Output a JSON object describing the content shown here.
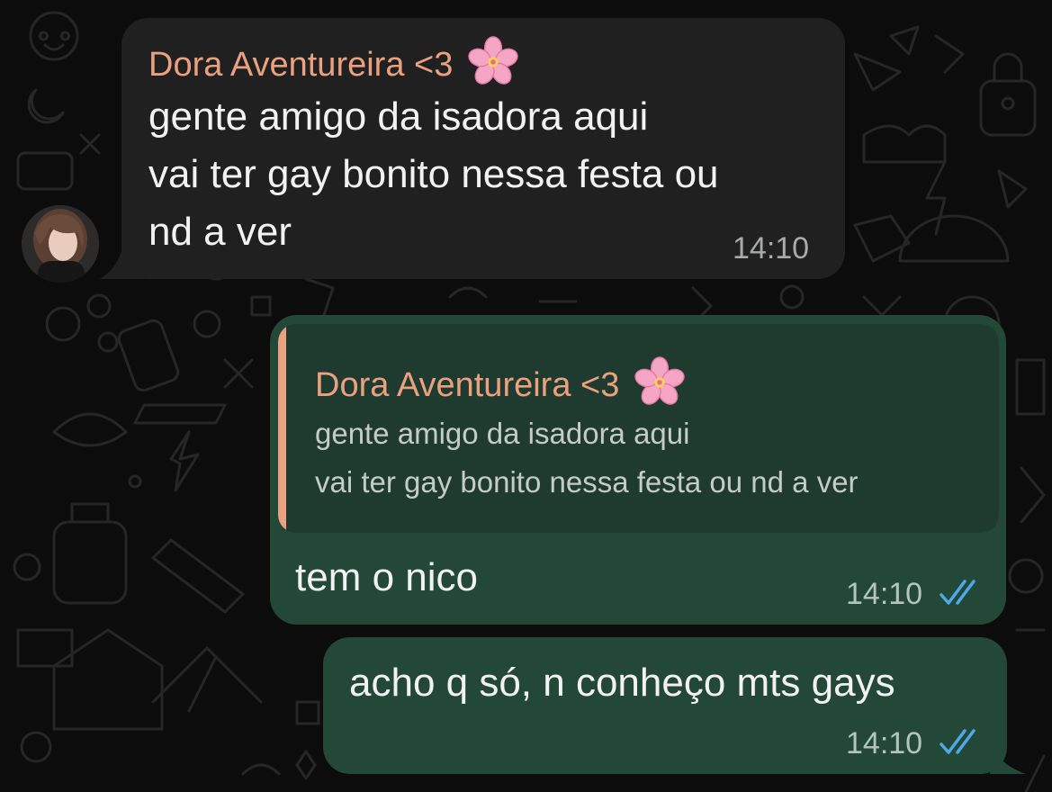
{
  "colors": {
    "background": "#0c0c0c",
    "incoming_bubble": "#202020",
    "outgoing_bubble": "#244838",
    "quote_background": "#1f3a2e",
    "sender_name": "#e9a17f",
    "read_ticks": "#4fa8e8"
  },
  "incoming_message": {
    "sender": "Dora Aventureira <3",
    "sender_emoji": "cherry-blossom-icon",
    "lines": [
      "gente amigo da isadora aqui",
      "vai ter gay bonito nessa festa ou",
      "nd a ver"
    ],
    "time": "14:10"
  },
  "reply_message": {
    "quoted": {
      "sender": "Dora Aventureira <3",
      "sender_emoji": "cherry-blossom-icon",
      "lines": [
        "gente amigo da isadora aqui",
        "vai ter gay bonito nessa festa ou nd a ver"
      ]
    },
    "text": "tem o nico",
    "time": "14:10",
    "status": "read"
  },
  "outgoing_message": {
    "text": "acho q só, n conheço mts gays",
    "time": "14:10",
    "status": "read"
  }
}
